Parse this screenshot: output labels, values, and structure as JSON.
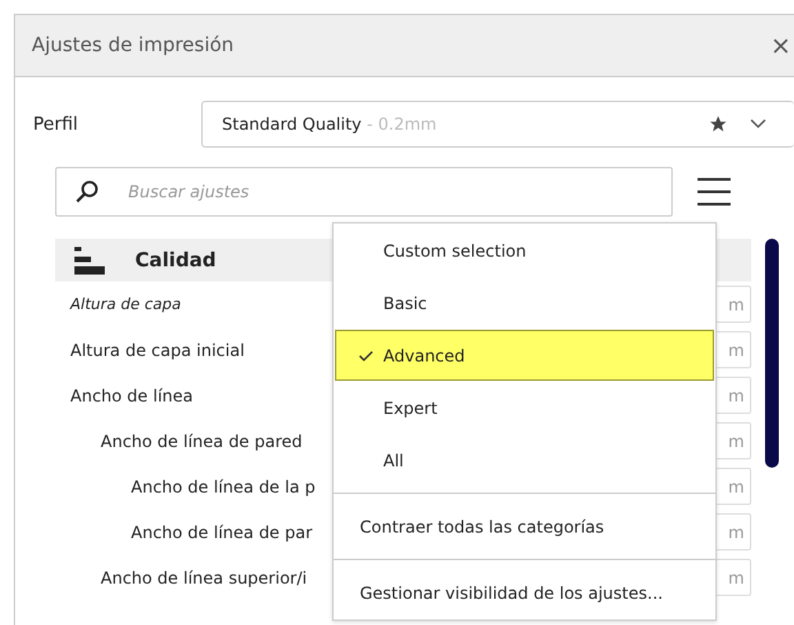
{
  "window": {
    "title": "Ajustes de impresión",
    "close": "×"
  },
  "profile": {
    "label": "Perfil",
    "value": "Standard Quality",
    "detail": " - 0.2mm"
  },
  "search": {
    "placeholder": "Buscar ajustes"
  },
  "category": {
    "label": "Calidad"
  },
  "settings": [
    {
      "label": "Altura de capa",
      "emphasized": true,
      "unit": "m"
    },
    {
      "label": "Altura de capa inicial",
      "emphasized": false,
      "unit": "m"
    },
    {
      "label": "Ancho de línea",
      "emphasized": false,
      "unit": "m",
      "children": [
        {
          "label": "Ancho de línea de pared",
          "emphasized": false,
          "unit": "m",
          "children": [
            {
              "label": "Ancho de línea de la p",
              "emphasized": false,
              "unit": "m"
            },
            {
              "label": "Ancho de línea de par",
              "emphasized": false,
              "unit": "m"
            }
          ]
        },
        {
          "label": "Ancho de línea superior/i",
          "emphasized": false,
          "unit": "m"
        }
      ]
    }
  ],
  "menu": {
    "items": [
      {
        "kind": "option",
        "label": "Custom selection",
        "selected": false
      },
      {
        "kind": "option",
        "label": "Basic",
        "selected": false
      },
      {
        "kind": "option",
        "label": "Advanced",
        "selected": true
      },
      {
        "kind": "option",
        "label": "Expert",
        "selected": false
      },
      {
        "kind": "option",
        "label": "All",
        "selected": false
      },
      {
        "kind": "separator"
      },
      {
        "kind": "action",
        "label": "Contraer todas las categorías"
      },
      {
        "kind": "separator"
      },
      {
        "kind": "action",
        "label": "Gestionar visibilidad de los ajustes..."
      }
    ]
  }
}
